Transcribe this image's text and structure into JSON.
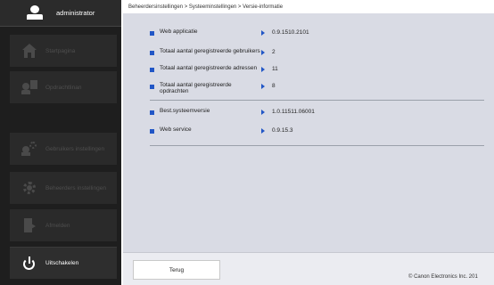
{
  "header": {
    "user": "administrator"
  },
  "sidebar": {
    "items": [
      {
        "label": "Startpagina",
        "icon": "home-icon"
      },
      {
        "label": "Opdrachtlinan",
        "icon": "user-document-icon"
      },
      {
        "label": "Gebruikers instellingen",
        "icon": "user-gear-icon"
      },
      {
        "label": "Beheerders instellingen",
        "icon": "gear-icon"
      },
      {
        "label": "Afmelden",
        "icon": "logout-icon"
      },
      {
        "label": "Uitschakelen",
        "icon": "power-icon"
      }
    ]
  },
  "breadcrumb": "Beheerdersinstellingen > Systeeminstellingen > Versie-informatie",
  "info": [
    {
      "label": "Web applicatie",
      "value": "0.9.1510.2101"
    },
    {
      "label": "Totaal aantal geregistreerde gebruikers",
      "value": "2"
    },
    {
      "label": "Totaal aantal geregistreerde adressen",
      "value": "11"
    },
    {
      "label": "Totaal aantal geregistreerde opdrachten",
      "value": "8"
    },
    {
      "label": "Best.systeemversie",
      "value": "1.0.11511.06001"
    },
    {
      "label": "Web service",
      "value": "0.9.15.3"
    }
  ],
  "footer": {
    "back_label": "Terug",
    "copyright": "© Canon Electronics Inc. 201"
  },
  "colors": {
    "accent": "#2156c6",
    "sidebar": "#1e1e1e",
    "main_bg": "#d9dbe4"
  }
}
